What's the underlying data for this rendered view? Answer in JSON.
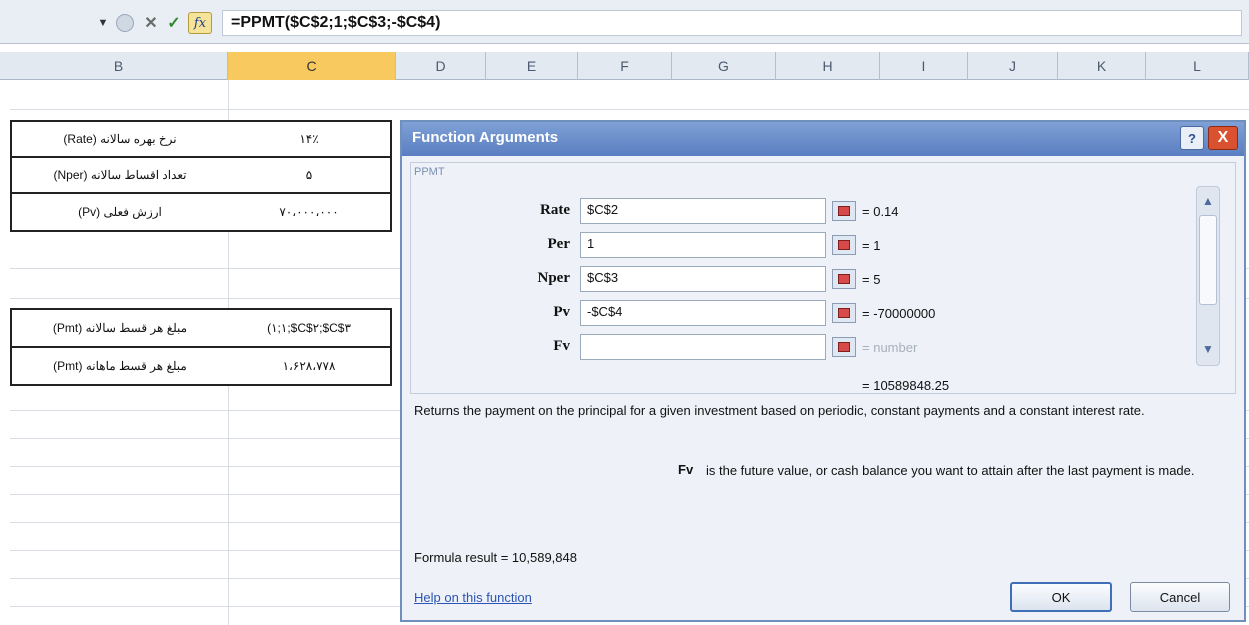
{
  "formula_bar": {
    "formula": "=PPMT($C$2;1;$C$3;-$C$4)",
    "fx_label": "fx"
  },
  "columns": [
    "B",
    "C",
    "D",
    "E",
    "F",
    "G",
    "H",
    "I",
    "J",
    "K",
    "L"
  ],
  "selected_column": "C",
  "sheet": {
    "table1": [
      {
        "label": "نرخ بهره سالانه (Rate)",
        "value": "۱۴٪"
      },
      {
        "label": "تعداد اقساط سالانه (Nper)",
        "value": "۵"
      },
      {
        "label": "ارزش فعلی (Pv)",
        "value": "۷۰،۰۰۰،۰۰۰"
      }
    ],
    "table2": [
      {
        "label": "مبلغ هر قسط سالانه (Pmt)",
        "value": "(۱;۱;$C$۲;$C$۳"
      },
      {
        "label": "مبلغ هر قسط ماهانه (Pmt)",
        "value": "۱،۶۲۸،۷۷۸"
      }
    ]
  },
  "dialog": {
    "title": "Function Arguments",
    "help_icon": "?",
    "close_icon": "X",
    "function_name": "PPMT",
    "args": [
      {
        "name": "Rate",
        "input": "$C$2",
        "value": "0.14"
      },
      {
        "name": "Per",
        "input": "1",
        "value": "1"
      },
      {
        "name": "Nper",
        "input": "$C$3",
        "value": "5"
      },
      {
        "name": "Pv",
        "input": "-$C$4",
        "value": "-70000000"
      },
      {
        "name": "Fv",
        "input": "",
        "value": "number"
      }
    ],
    "result": "10589848.25",
    "description": "Returns the payment on the principal for a given investment based on periodic, constant payments and a constant interest rate.",
    "arg_help_name": "Fv",
    "arg_help_text": "is the future value, or cash balance you want to attain after the last payment is made.",
    "formula_result_label": "Formula result =",
    "formula_result_value": "10,589,848",
    "help_link": "Help on this function",
    "ok_label": "OK",
    "cancel_label": "Cancel"
  },
  "colors": {
    "selected_column": "#f7c95e",
    "title_bar": "#5a7fc1",
    "close_button": "#d9512e"
  }
}
